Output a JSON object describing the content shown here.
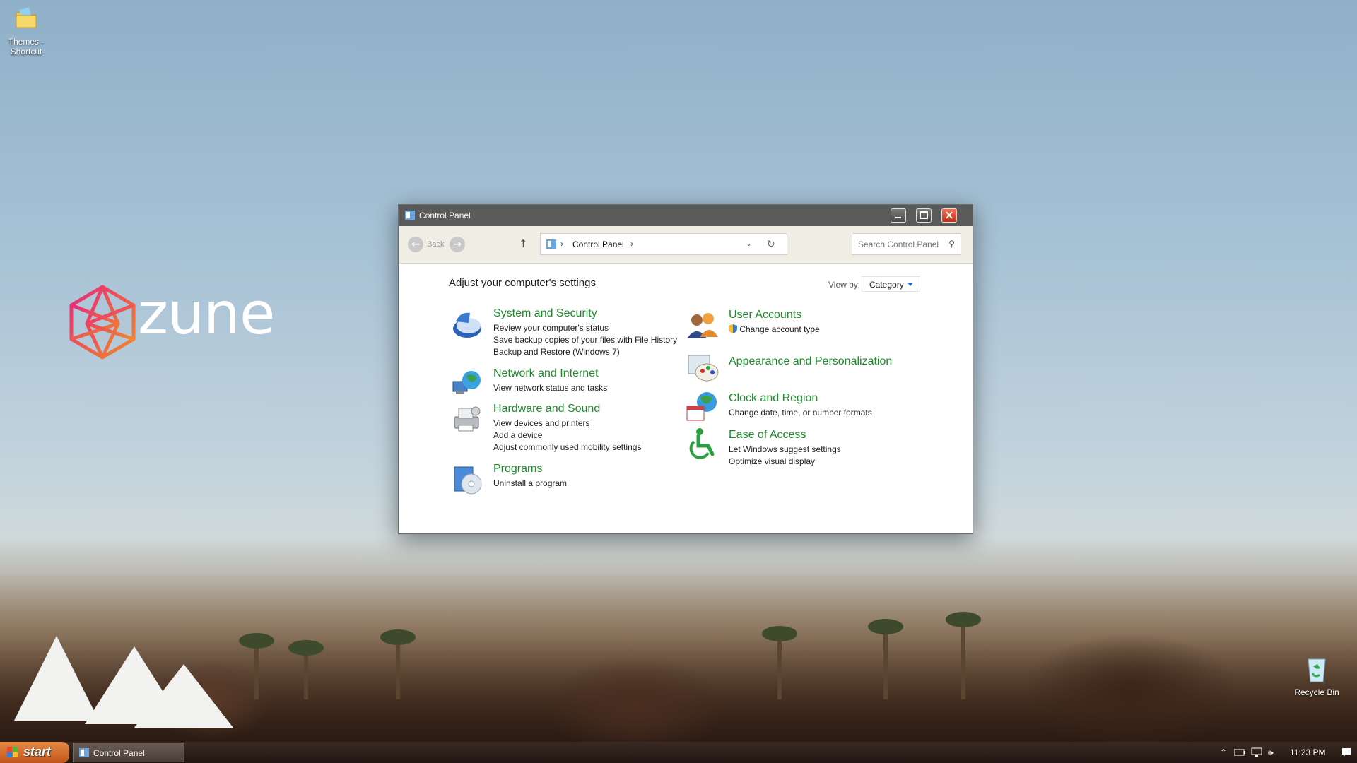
{
  "desktop": {
    "icons": [
      {
        "label": "Themes - Shortcut"
      },
      {
        "label": "Recycle Bin"
      }
    ],
    "wallpaper_logo": "zune"
  },
  "window": {
    "title": "Control Panel",
    "toolbar": {
      "back_label": "Back",
      "breadcrumb": "Control Panel",
      "search_placeholder": "Search Control Panel"
    },
    "heading": "Adjust your computer's settings",
    "view_by_label": "View by:",
    "view_by_value": "Category",
    "categories_left": [
      {
        "title": "System and Security",
        "links": [
          "Review your computer's status",
          "Save backup copies of your files with File History",
          "Backup and Restore (Windows 7)"
        ]
      },
      {
        "title": "Network and Internet",
        "links": [
          "View network status and tasks"
        ]
      },
      {
        "title": "Hardware and Sound",
        "links": [
          "View devices and printers",
          "Add a device",
          "Adjust commonly used mobility settings"
        ]
      },
      {
        "title": "Programs",
        "links": [
          "Uninstall a program"
        ]
      }
    ],
    "categories_right": [
      {
        "title": "User Accounts",
        "links": [
          "Change account type"
        ]
      },
      {
        "title": "Appearance and Personalization",
        "links": []
      },
      {
        "title": "Clock and Region",
        "links": [
          "Change date, time, or number formats"
        ]
      },
      {
        "title": "Ease of Access",
        "links": [
          "Let Windows suggest settings",
          "Optimize visual display"
        ]
      }
    ]
  },
  "taskbar": {
    "start_label": "start",
    "items": [
      {
        "label": "Control Panel"
      }
    ],
    "clock": "11:23 PM"
  },
  "colors": {
    "link_green": "#1f8a2c",
    "titlebar": "#5a5a5a",
    "taskbar": "#2e211b",
    "start": "#d46a2c"
  }
}
